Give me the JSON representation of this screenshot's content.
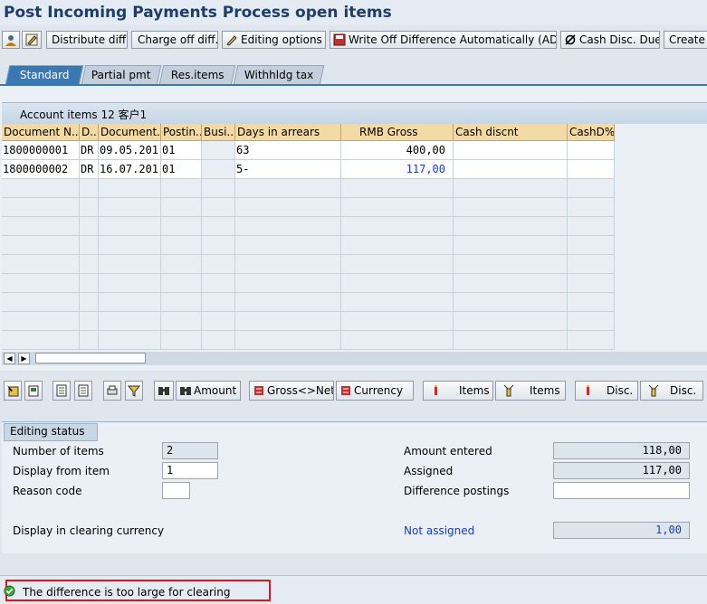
{
  "window": {
    "title": "Post Incoming Payments Process open items"
  },
  "toolbar": {
    "distribute_label": "Distribute diff.",
    "chargeoff_label": "Charge off diff.",
    "editing_label": "Editing options",
    "writeoff_label": "Write Off Difference Automatically (AD)",
    "cashdisc_label": "Cash Disc. Due",
    "create_label": "Create"
  },
  "tabs": [
    "Standard",
    "Partial pmt",
    "Res.items",
    "Withhldg tax"
  ],
  "grid": {
    "title": "Account items 12 客户1",
    "columns": [
      "Document N...",
      "D...",
      "Document...",
      "Postin...",
      "Busi...",
      "Days in arrears",
      "RMB Gross",
      "Cash discnt",
      "CashD%"
    ],
    "rows": [
      {
        "doc": "1800000001",
        "type": "DR",
        "date": "09.05.201",
        "post": "01",
        "busi": "",
        "days": "63",
        "gross": "400,00",
        "discnt": "",
        "pct": ""
      },
      {
        "doc": "1800000002",
        "type": "DR",
        "date": "16.07.201",
        "post": "01",
        "busi": "",
        "days": "5-",
        "gross": "117,00",
        "discnt": "",
        "pct": ""
      }
    ]
  },
  "bottom_toolbar": {
    "amount_label": "Amount",
    "grossnet_label": "Gross<>Net",
    "currency_label": "Currency",
    "items_label": "Items",
    "items2_label": "Items",
    "disc_label": "Disc.",
    "disc2_label": "Disc."
  },
  "editing": {
    "tab_label": "Editing status",
    "num_items_label": "Number of items",
    "num_items_value": "2",
    "display_from_label": "Display from item",
    "display_from_value": "1",
    "reason_label": "Reason code",
    "reason_value": "",
    "clearing_currency_label": "Display in clearing currency",
    "amount_entered_label": "Amount entered",
    "amount_entered_value": "118,00",
    "assigned_label": "Assigned",
    "assigned_value": "117,00",
    "diff_postings_label": "Difference postings",
    "diff_postings_value": "",
    "not_assigned_label": "Not assigned",
    "not_assigned_value": "1,00"
  },
  "status": {
    "message": "The difference is too large for clearing"
  },
  "colors": {
    "header_bg": "#f3d9a3",
    "active_tab": "#3a78b3",
    "status_outline": "#e0141c",
    "blue_value": "#1a3cc4"
  }
}
